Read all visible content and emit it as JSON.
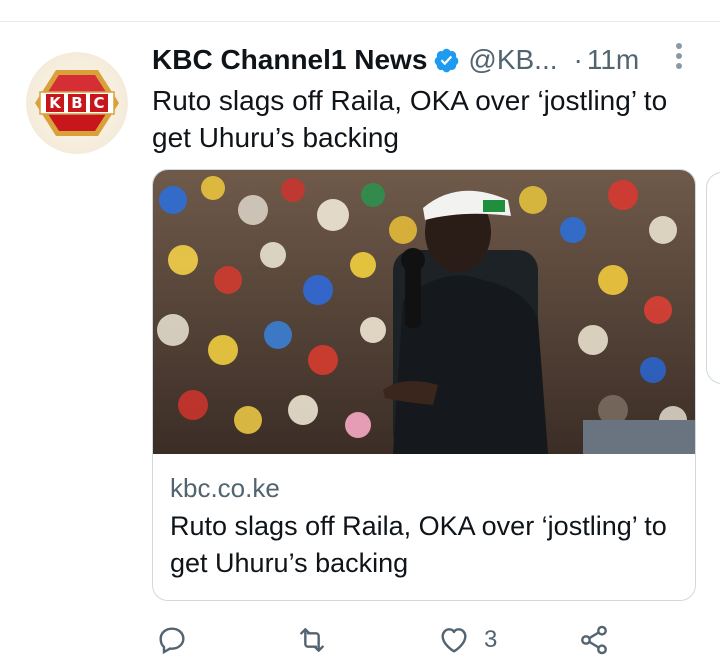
{
  "tweet": {
    "display_name": "KBC Channel1 News",
    "verified": true,
    "handle": "@KB...",
    "separator": "·",
    "time": "11m",
    "text": "Ruto slags off Raila, OKA over ‘jostling’ to get Uhuru’s backing",
    "avatar": {
      "logo_text": "KBC",
      "colors": {
        "red": "#c8161d",
        "gold": "#d9a13b"
      }
    }
  },
  "card": {
    "image_description_icon": "photo",
    "domain": "kbc.co.ke",
    "title": "Ruto slags off Raila, OKA over ‘jostling’ to get Uhuru’s backing"
  },
  "actions": {
    "reply": {
      "icon": "reply-icon"
    },
    "retweet": {
      "icon": "retweet-icon"
    },
    "like": {
      "icon": "heart-icon",
      "count": "3"
    },
    "share": {
      "icon": "share-icon"
    }
  },
  "colors": {
    "text": "#0f1419",
    "muted": "#536471",
    "border": "#cfd9de",
    "verified": "#1d9bf0"
  }
}
